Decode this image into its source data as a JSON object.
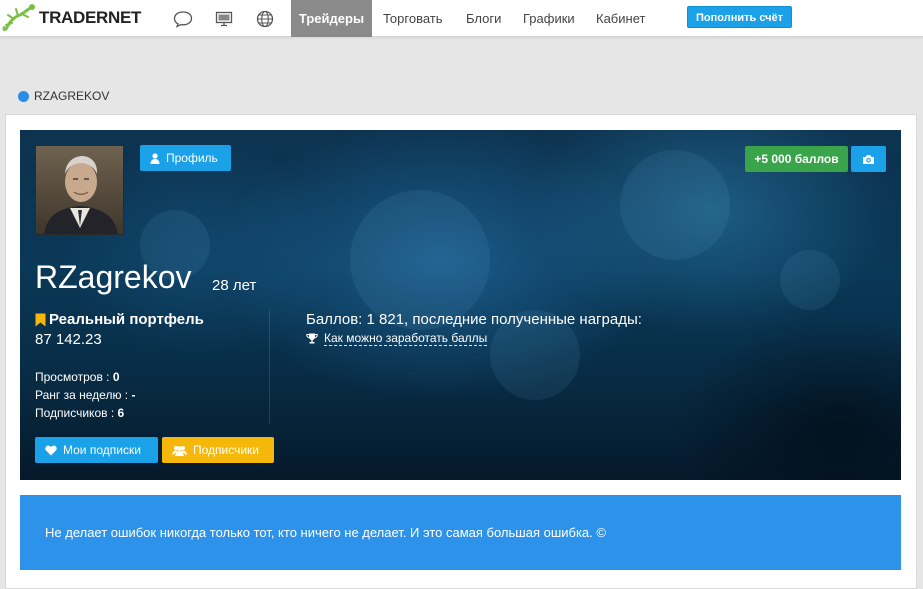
{
  "navbar": {
    "logo_text": "TRADERNET",
    "icons": [
      "chat-icon",
      "monitor-icon",
      "globe-icon"
    ],
    "links": [
      {
        "label": "Трейдеры",
        "active": true
      },
      {
        "label": "Торговать",
        "active": false
      },
      {
        "label": "Блоги",
        "active": false
      },
      {
        "label": "Графики",
        "active": false
      },
      {
        "label": "Кабинет",
        "active": false
      }
    ],
    "topup_label": "Пополнить счёт"
  },
  "breadcrumb": {
    "text": "RZAGREKOV"
  },
  "profile": {
    "profile_button": "Профиль",
    "points_button": "+5 000 баллов",
    "username": "RZagrekov",
    "age": "28 лет",
    "portfolio_title": "Реальный портфель",
    "portfolio_value": "87 142.23",
    "stats": {
      "views_label": "Просмотров : ",
      "views_value": "0",
      "rank_label": "Ранг за неделю : ",
      "rank_value": "-",
      "subscribers_label": "Подписчиков : ",
      "subscribers_value": "6"
    },
    "score_text": "Баллов: 1 821, последние полученные награды:",
    "howto_link": "Как можно заработать баллы",
    "my_subscriptions_button": "Мои подписки",
    "followers_button": "Подписчики"
  },
  "quote": {
    "text": "Не делает ошибок никогда только тот, кто ничего не делает. И это самая большая ошибка. ©"
  },
  "colors": {
    "accent_blue": "#1ba1e8",
    "points_green": "#3aa44a",
    "followers_yellow": "#f5b80a",
    "quote_blue": "#2d93ea",
    "active_nav": "#8a8a8a"
  }
}
